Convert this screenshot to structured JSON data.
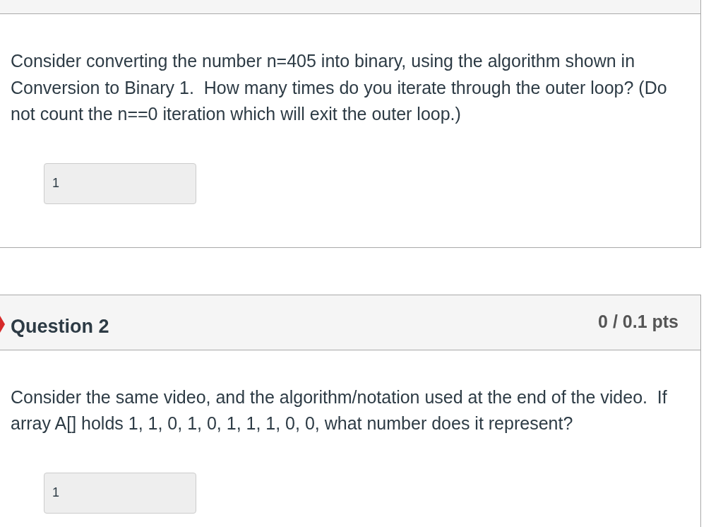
{
  "questions": [
    {
      "prompt": "Consider converting the number n=405 into binary, using the algorithm shown in Conversion to Binary 1.  How many times do you iterate through the outer loop? (Do not count the n==0 iteration which will exit the outer loop.)",
      "answer": "1"
    },
    {
      "title": "Question 2",
      "points": "0 / 0.1 pts",
      "incorrect": true,
      "prompt": "Consider the same video, and the algorithm/notation used at the end of the video.  If array A[] holds 1, 1, 0, 1, 0, 1, 1, 1, 0, 0, what number does it represent?",
      "answer": "1"
    }
  ]
}
